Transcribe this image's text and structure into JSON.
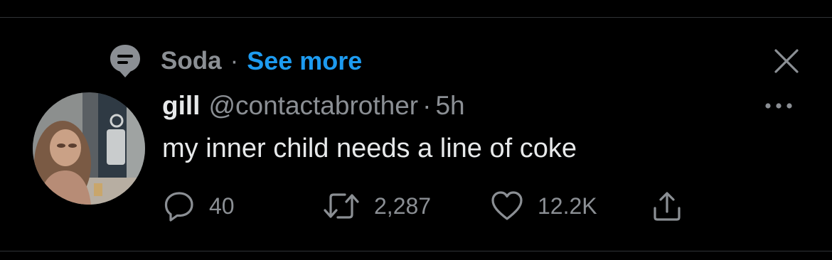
{
  "topic": {
    "name": "Soda",
    "separator": "·",
    "see_more_label": "See more",
    "icon": "topic-speech-bubble-icon"
  },
  "controls": {
    "close_icon": "close-icon",
    "more_icon": "more-options-icon"
  },
  "tweet": {
    "display_name": "gill",
    "handle": "@contactabrother",
    "separator": "·",
    "time": "5h",
    "text": "my inner child needs a line of coke",
    "avatar_icon": "avatar"
  },
  "actions": {
    "reply": {
      "icon": "reply-icon",
      "count": "40"
    },
    "retweet": {
      "icon": "retweet-icon",
      "count": "2,287"
    },
    "like": {
      "icon": "heart-icon",
      "count": "12.2K"
    },
    "share": {
      "icon": "share-icon"
    }
  },
  "colors": {
    "background": "#000000",
    "primary_text": "#e7e9ea",
    "secondary_text": "#8b8f94",
    "accent": "#1d9bf0",
    "divider": "#2f3336"
  }
}
